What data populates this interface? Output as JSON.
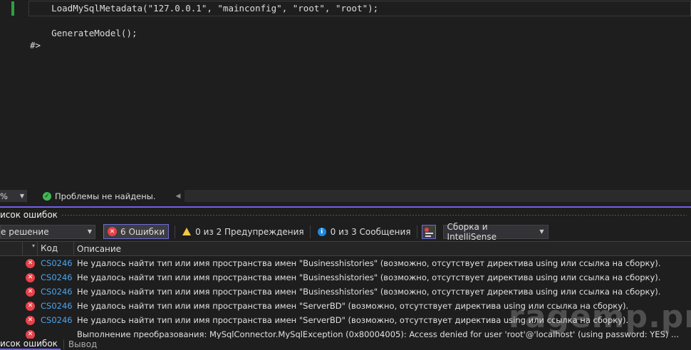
{
  "editor": {
    "lines": [
      "    LoadMySqlMetadata(\"127.0.0.1\", \"mainconfig\", \"root\", \"root\");",
      "",
      "    GenerateModel();",
      "#>"
    ]
  },
  "editor_status": {
    "zoom": "%",
    "message": "Проблемы не найдены."
  },
  "panel": {
    "title": "исок ошибок"
  },
  "toolbar": {
    "scope": "е решение",
    "errors": "6 Ошибки",
    "warnings": "0 из 2 Предупреждения",
    "messages": "0 из 3 Сообщения",
    "build_filter": "Сборка и IntelliSense"
  },
  "table": {
    "col_code": "Код",
    "col_desc": "Описание",
    "rows": [
      {
        "code": "CS0246",
        "desc": "Не удалось найти тип или имя пространства имен \"Businesshistories\" (возможно, отсутствует директива using или ссылка на сборку)."
      },
      {
        "code": "CS0246",
        "desc": "Не удалось найти тип или имя пространства имен \"Businesshistories\" (возможно, отсутствует директива using или ссылка на сборку)."
      },
      {
        "code": "CS0246",
        "desc": "Не удалось найти тип или имя пространства имен \"Businesshistories\" (возможно, отсутствует директива using или ссылка на сборку)."
      },
      {
        "code": "CS0246",
        "desc": "Не удалось найти тип или имя пространства имен \"ServerBD\" (возможно, отсутствует директива using или ссылка на сборку)."
      },
      {
        "code": "CS0246",
        "desc": "Не удалось найти тип или имя пространства имен \"ServerBD\" (возможно, отсутствует директива using или ссылка на сборку)."
      },
      {
        "code": "",
        "desc": "Выполнение преобразования: MySqlConnector.MySqlException (0x80004005): Access denied for user 'root'@'localhost' (using password: YES) ..."
      }
    ]
  },
  "bottom_tabs": {
    "active": "исок ошибок",
    "other": "Вывод"
  },
  "watermark": "ragemp.pro",
  "icons": {
    "error": "error-circle-icon",
    "warning": "warning-triangle-icon",
    "info": "info-circle-icon",
    "ok": "check-circle-icon"
  }
}
